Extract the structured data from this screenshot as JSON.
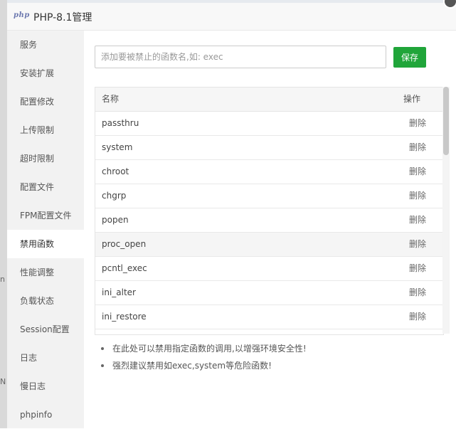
{
  "dialog": {
    "logo_text": "php",
    "title": "PHP-8.1管理"
  },
  "sidebar": {
    "items": [
      {
        "label": "服务"
      },
      {
        "label": "安装扩展"
      },
      {
        "label": "配置修改"
      },
      {
        "label": "上传限制"
      },
      {
        "label": "超时限制"
      },
      {
        "label": "配置文件"
      },
      {
        "label": "FPM配置文件"
      },
      {
        "label": "禁用函数"
      },
      {
        "label": "性能调整"
      },
      {
        "label": "负载状态"
      },
      {
        "label": "Session配置"
      },
      {
        "label": "日志"
      },
      {
        "label": "慢日志"
      },
      {
        "label": "phpinfo"
      }
    ],
    "active_label": "禁用函数"
  },
  "add_function": {
    "placeholder": "添加要被禁止的函数名,如: exec",
    "value": "",
    "save_label": "保存"
  },
  "table": {
    "headers": {
      "name": "名称",
      "action": "操作"
    },
    "rows": [
      {
        "name": "passthru",
        "action": "删除"
      },
      {
        "name": "system",
        "action": "删除"
      },
      {
        "name": "chroot",
        "action": "删除"
      },
      {
        "name": "chgrp",
        "action": "删除"
      },
      {
        "name": "popen",
        "action": "删除"
      },
      {
        "name": "proc_open",
        "action": "删除"
      },
      {
        "name": "pcntl_exec",
        "action": "删除"
      },
      {
        "name": "ini_alter",
        "action": "删除"
      },
      {
        "name": "ini_restore",
        "action": "删除"
      }
    ],
    "hovered_row": "proc_open"
  },
  "tips": [
    "在此处可以禁用指定函数的调用,以增强环境安全性!",
    "强烈建议禁用如exec,system等危险函数!"
  ],
  "colors": {
    "accent_green": "#20a53a",
    "sidebar_bg": "#f2f2f2",
    "php_logo": "#6c78af"
  }
}
